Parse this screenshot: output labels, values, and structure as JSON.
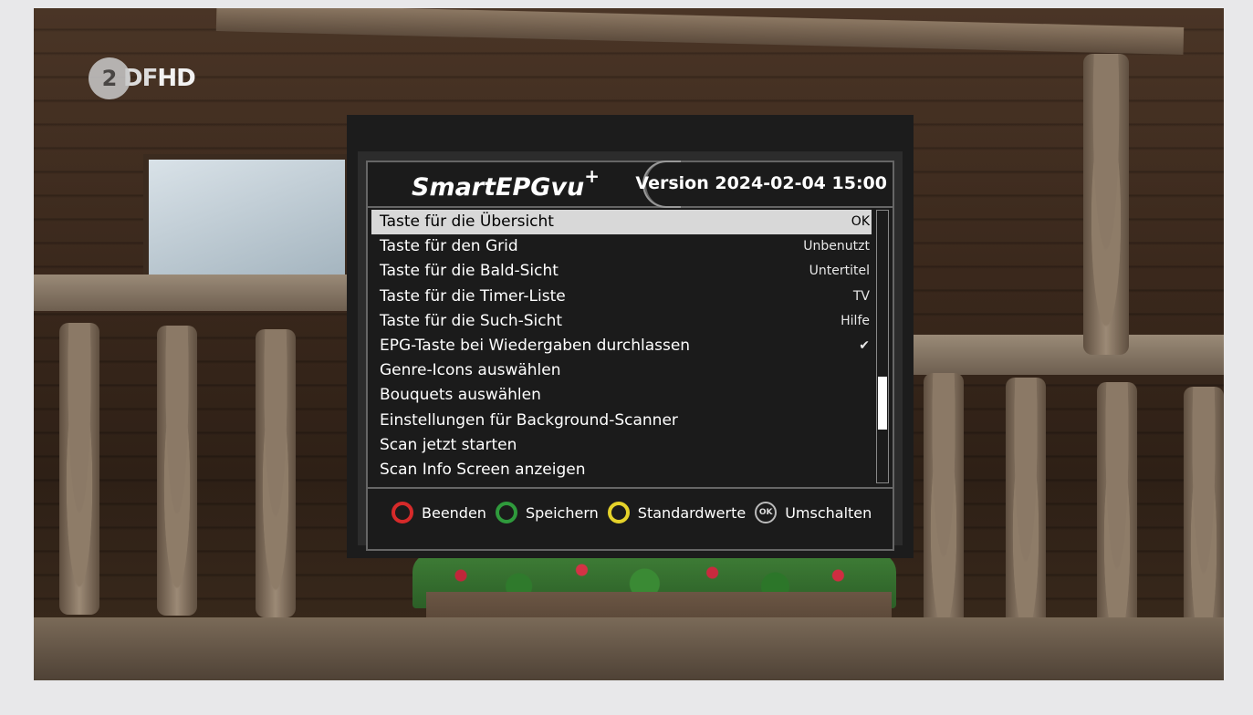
{
  "channel_logo": {
    "circle_text": "2",
    "text_a": "DF",
    "text_b": "HD"
  },
  "plugin": {
    "title": "SmartEPGvu",
    "title_sup": "+",
    "version": "Version 2024-02-04 15:00"
  },
  "settings": [
    {
      "label": "Taste für die Übersicht",
      "value": "OK",
      "selected": true
    },
    {
      "label": "Taste für den Grid",
      "value": "Unbenutzt"
    },
    {
      "label": "Taste für die Bald-Sicht",
      "value": "Untertitel"
    },
    {
      "label": "Taste für die Timer-Liste",
      "value": "TV"
    },
    {
      "label": "Taste für die Such-Sicht",
      "value": "Hilfe"
    },
    {
      "label": "EPG-Taste bei Wiedergaben durchlassen",
      "value": "✔"
    },
    {
      "label": "Genre-Icons auswählen",
      "value": ""
    },
    {
      "label": "Bouquets auswählen",
      "value": ""
    },
    {
      "label": "Einstellungen für Background-Scanner",
      "value": ""
    },
    {
      "label": "Scan jetzt starten",
      "value": ""
    },
    {
      "label": "Scan Info Screen anzeigen",
      "value": ""
    }
  ],
  "footer": {
    "red": "Beenden",
    "green": "Speichern",
    "yellow": "Standardwerte",
    "ok_icon": "OK",
    "ok": "Umschalten"
  },
  "icons": {
    "red": "red-button-icon",
    "green": "green-button-icon",
    "yellow": "yellow-button-icon",
    "ok": "ok-button-icon",
    "check": "checkmark-icon"
  },
  "colors": {
    "selection": "#d8d8d8",
    "red": "#d62a2a",
    "green": "#2f9a3c",
    "yellow": "#e5d22a"
  }
}
